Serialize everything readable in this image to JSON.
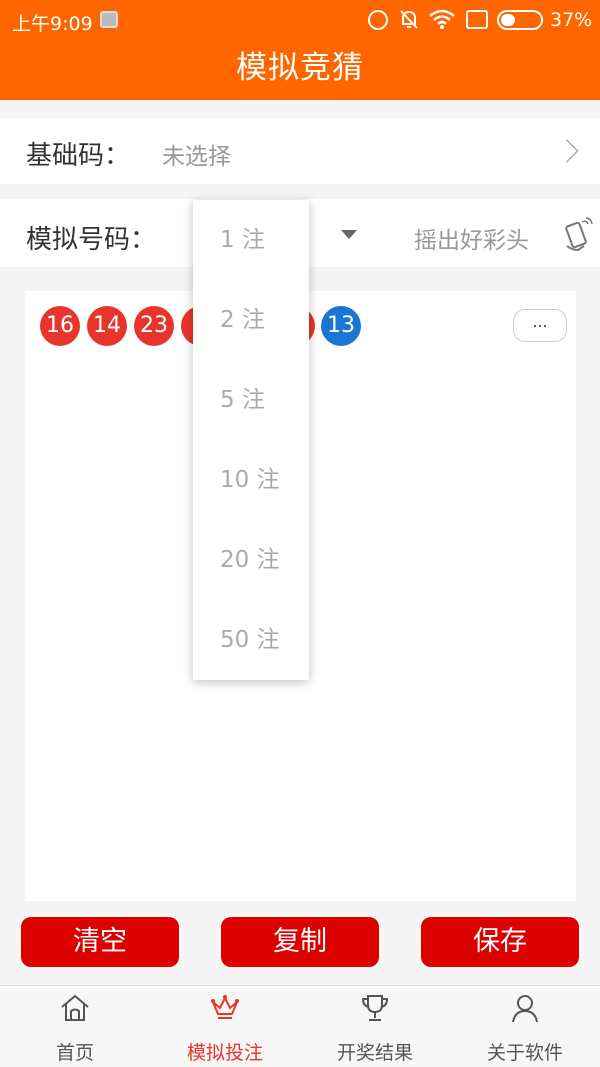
{
  "status_bar": {
    "time": "上午9:09",
    "battery": "37%"
  },
  "title": "模拟竞猜",
  "base_code": {
    "label": "基础码：",
    "value": "未选择"
  },
  "sim_number": {
    "label": "模拟号码：",
    "shake_label": "摇出好彩头"
  },
  "balls": {
    "red": [
      "16",
      "14",
      "23",
      "",
      ""
    ],
    "blue": "13"
  },
  "more_button": "...",
  "dropdown": {
    "options": [
      "1 注",
      "2 注",
      "5 注",
      "10 注",
      "20 注",
      "50 注"
    ]
  },
  "actions": {
    "clear": "清空",
    "copy": "复制",
    "save": "保存"
  },
  "nav": {
    "items": [
      {
        "label": "首页",
        "icon": "home-icon"
      },
      {
        "label": "模拟投注",
        "icon": "crown-icon"
      },
      {
        "label": "开奖结果",
        "icon": "trophy-icon"
      },
      {
        "label": "关于软件",
        "icon": "user-icon"
      }
    ]
  },
  "colors": {
    "header": "#ff6600",
    "red_ball": "#e8352b",
    "blue_ball": "#1976d2",
    "action_button": "#dd0000"
  }
}
